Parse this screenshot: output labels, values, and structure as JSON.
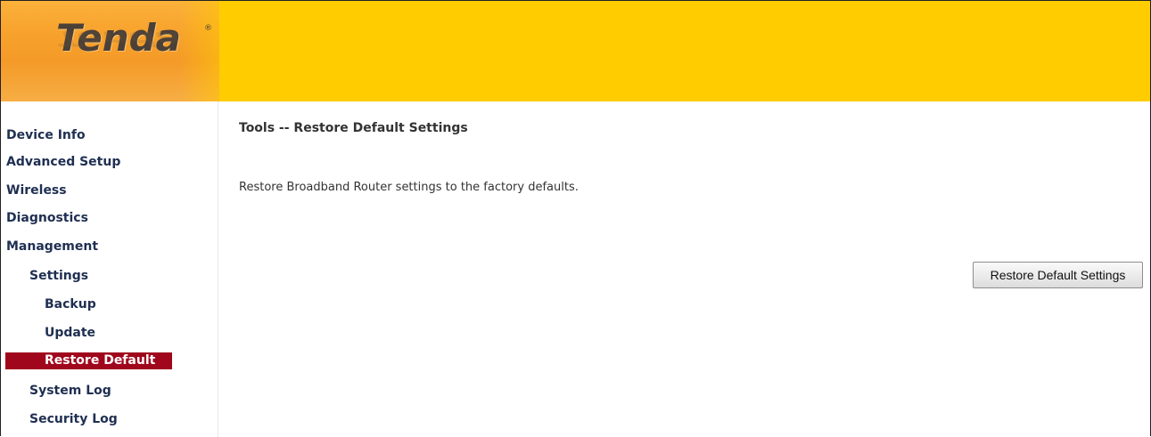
{
  "header": {
    "logo_text": "Tenda",
    "logo_mark": "®"
  },
  "sidebar": {
    "items": [
      {
        "label": "Device Info"
      },
      {
        "label": "Advanced Setup"
      },
      {
        "label": "Wireless"
      },
      {
        "label": "Diagnostics"
      },
      {
        "label": "Management"
      },
      {
        "label": "Settings"
      },
      {
        "label": "Backup"
      },
      {
        "label": "Update"
      },
      {
        "label": "Restore Default"
      },
      {
        "label": "System Log"
      },
      {
        "label": "Security Log"
      }
    ],
    "active_item": "Restore Default"
  },
  "main": {
    "title": "Tools -- Restore Default Settings",
    "description": "Restore Broadband Router settings to the factory defaults.",
    "restore_button_label": "Restore Default Settings"
  },
  "colors": {
    "header_yellow": "#ffcc00",
    "header_orange": "#f7a12c",
    "active_nav_bg": "#a0061c",
    "nav_text": "#1f2f52"
  }
}
